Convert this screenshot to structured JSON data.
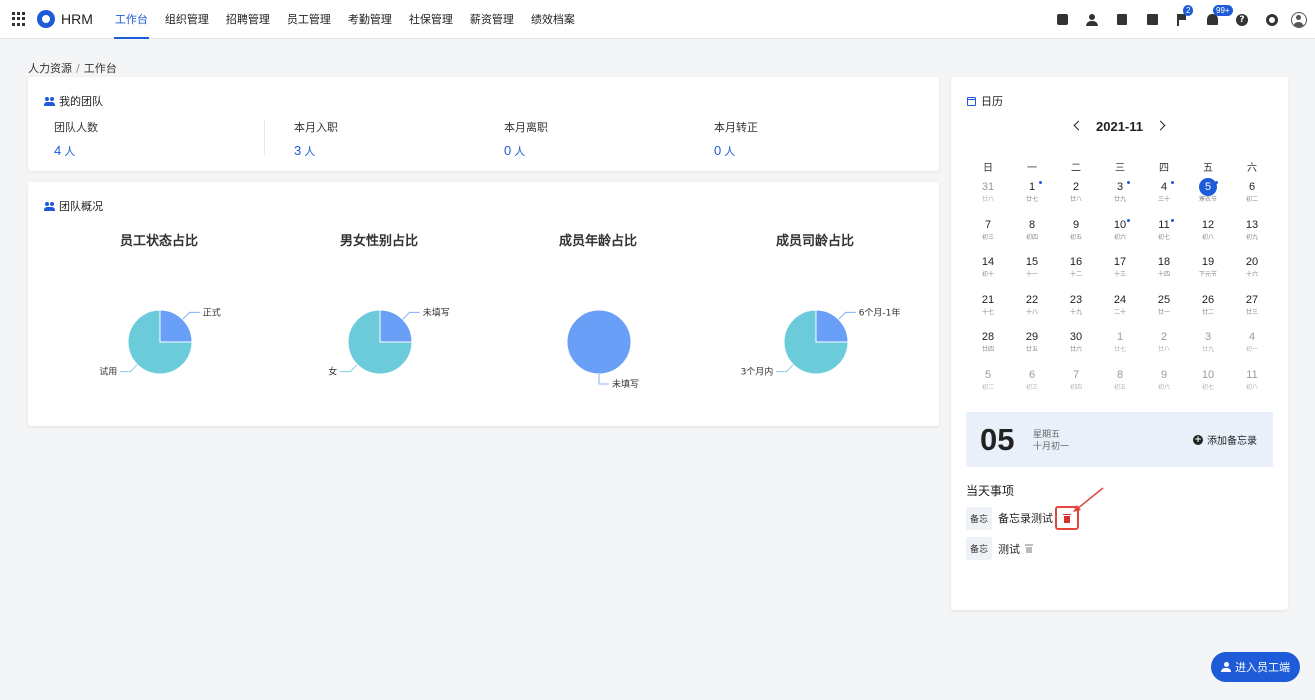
{
  "brand": "HRM",
  "nav": [
    "工作台",
    "组织管理",
    "招聘管理",
    "员工管理",
    "考勤管理",
    "社保管理",
    "薪资管理",
    "绩效档案"
  ],
  "toolbar": {
    "flag_badge": "2",
    "bell_badge": "99+",
    "help_glyph": "?",
    "icons": [
      "checklist-icon",
      "user-icon",
      "document-icon",
      "calendar-icon",
      "flag-icon",
      "bell-icon",
      "help-icon",
      "gear-icon",
      "avatar-icon"
    ]
  },
  "breadcrumb": {
    "root": "人力资源",
    "separator": "/",
    "current": "工作台"
  },
  "my_team": {
    "title": "我的团队",
    "stats": [
      {
        "label": "团队人数",
        "value": "4",
        "unit": "人"
      },
      {
        "label": "本月入职",
        "value": "3",
        "unit": "人"
      },
      {
        "label": "本月离职",
        "value": "0",
        "unit": "人"
      },
      {
        "label": "本月转正",
        "value": "0",
        "unit": "人"
      }
    ]
  },
  "overview": {
    "title": "团队概况",
    "colors": {
      "primary": "#6a9ff7",
      "secondary": "#6ccbda"
    }
  },
  "chart_data": [
    {
      "type": "pie",
      "title": "员工状态占比",
      "labels": [
        "正式",
        "试用"
      ],
      "values": [
        1,
        3
      ]
    },
    {
      "type": "pie",
      "title": "男女性别占比",
      "labels": [
        "未填写",
        "女"
      ],
      "values": [
        1,
        3
      ]
    },
    {
      "type": "pie",
      "title": "成员年龄占比",
      "labels": [
        "未填写"
      ],
      "values": [
        4
      ]
    },
    {
      "type": "pie",
      "title": "成员司龄占比",
      "labels": [
        "6个月-1年",
        "3个月内"
      ],
      "values": [
        1,
        3
      ]
    }
  ],
  "calendar": {
    "title": "日历",
    "month_label": "2021-11",
    "weekdays": [
      "日",
      "一",
      "二",
      "三",
      "四",
      "五",
      "六"
    ],
    "days": [
      {
        "d": "31",
        "l": "廿六",
        "muted": true
      },
      {
        "d": "1",
        "l": "廿七",
        "dot": true
      },
      {
        "d": "2",
        "l": "廿八"
      },
      {
        "d": "3",
        "l": "廿九",
        "dot": true
      },
      {
        "d": "4",
        "l": "三十",
        "dot": true
      },
      {
        "d": "5",
        "l": "寒衣节",
        "today": true,
        "dot": true
      },
      {
        "d": "6",
        "l": "初二"
      },
      {
        "d": "7",
        "l": "初三"
      },
      {
        "d": "8",
        "l": "初四"
      },
      {
        "d": "9",
        "l": "初五"
      },
      {
        "d": "10",
        "l": "初六",
        "dot": true
      },
      {
        "d": "11",
        "l": "初七",
        "dot": true
      },
      {
        "d": "12",
        "l": "初八"
      },
      {
        "d": "13",
        "l": "初九"
      },
      {
        "d": "14",
        "l": "初十"
      },
      {
        "d": "15",
        "l": "十一"
      },
      {
        "d": "16",
        "l": "十二"
      },
      {
        "d": "17",
        "l": "十三"
      },
      {
        "d": "18",
        "l": "十四"
      },
      {
        "d": "19",
        "l": "下元节"
      },
      {
        "d": "20",
        "l": "十六"
      },
      {
        "d": "21",
        "l": "十七"
      },
      {
        "d": "22",
        "l": "十八"
      },
      {
        "d": "23",
        "l": "十九"
      },
      {
        "d": "24",
        "l": "二十"
      },
      {
        "d": "25",
        "l": "廿一"
      },
      {
        "d": "26",
        "l": "廿二"
      },
      {
        "d": "27",
        "l": "廿三"
      },
      {
        "d": "28",
        "l": "廿四"
      },
      {
        "d": "29",
        "l": "廿五"
      },
      {
        "d": "30",
        "l": "廿六"
      },
      {
        "d": "1",
        "l": "廿七",
        "muted": true
      },
      {
        "d": "2",
        "l": "廿八",
        "muted": true
      },
      {
        "d": "3",
        "l": "廿九",
        "muted": true
      },
      {
        "d": "4",
        "l": "初一",
        "muted": true
      },
      {
        "d": "5",
        "l": "初二",
        "muted": true
      },
      {
        "d": "6",
        "l": "初三",
        "muted": true
      },
      {
        "d": "7",
        "l": "初四",
        "muted": true
      },
      {
        "d": "8",
        "l": "初五",
        "muted": true
      },
      {
        "d": "9",
        "l": "初六",
        "muted": true
      },
      {
        "d": "10",
        "l": "初七",
        "muted": true
      },
      {
        "d": "11",
        "l": "初八",
        "muted": true
      }
    ]
  },
  "today": {
    "day": "05",
    "weekday": "星期五",
    "lunar": "十月初一",
    "add_label": "添加备忘录"
  },
  "events": {
    "title": "当天事项",
    "items": [
      {
        "tag": "备忘",
        "text": "备忘录测试",
        "highlighted": true
      },
      {
        "tag": "备忘",
        "text": "测试",
        "highlighted": false
      }
    ]
  },
  "enter_button": "进入员工端"
}
